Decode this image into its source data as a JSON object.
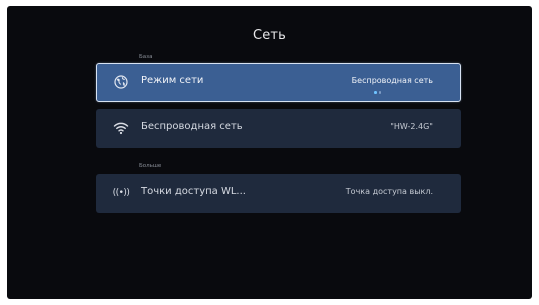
{
  "page": {
    "title": "Сеть"
  },
  "sections": [
    {
      "label": "База",
      "rows": [
        {
          "label": "Режим сети",
          "value": "Беспроводная сеть",
          "icon": "globe-icon",
          "selected": true
        },
        {
          "label": "Беспроводная сеть",
          "value": "\"HW-2.4G\"",
          "icon": "wifi-icon",
          "selected": false
        }
      ]
    },
    {
      "label": "Больше",
      "rows": [
        {
          "label": "Точки доступа WL...",
          "value": "Точка доступа выкл.",
          "icon": "hotspot-icon",
          "icon_glyph": "((•))",
          "selected": false
        }
      ]
    }
  ],
  "colors": {
    "background": "#090a0e",
    "row": "#1f2a3d",
    "row_selected": "#3b5f93",
    "accent": "#6fc3ff"
  }
}
